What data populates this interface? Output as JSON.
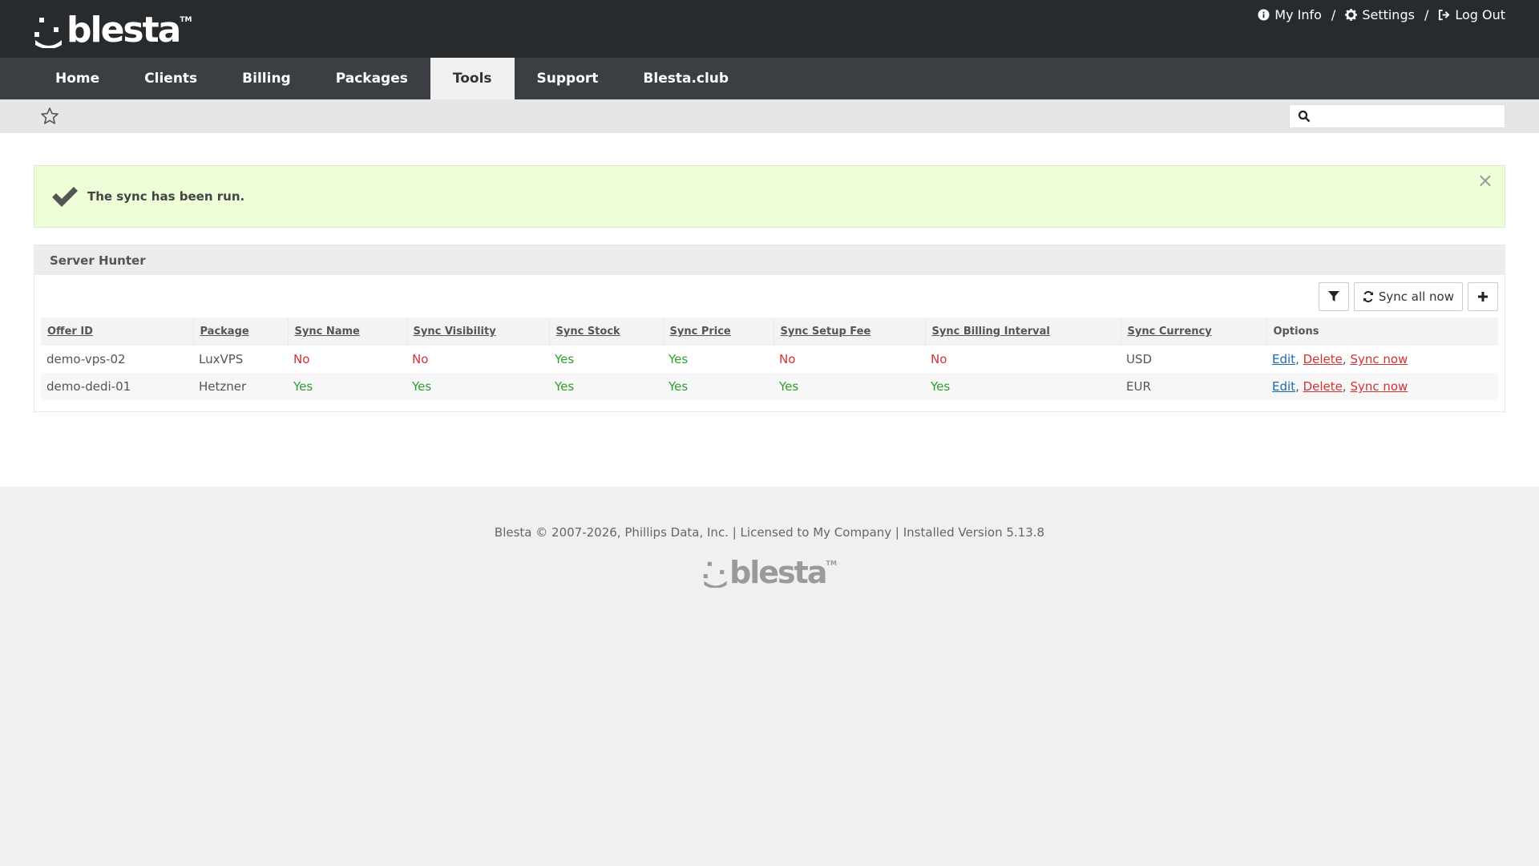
{
  "brand": {
    "name": "blesta",
    "tm": "TM"
  },
  "toplinks": {
    "my_info": "My Info",
    "settings": "Settings",
    "logout": "Log Out",
    "sep": "/"
  },
  "nav": [
    "Home",
    "Clients",
    "Billing",
    "Packages",
    "Tools",
    "Support",
    "Blesta.club"
  ],
  "nav_active": "Tools",
  "search": {
    "placeholder": ""
  },
  "alert": {
    "message": "The sync has been run.",
    "close": "×"
  },
  "panel": {
    "title": "Server Hunter",
    "sync_all_label": "Sync all now"
  },
  "table": {
    "headers": [
      "Offer ID",
      "Package",
      "Sync Name",
      "Sync Visibility",
      "Sync Stock",
      "Sync Price",
      "Sync Setup Fee",
      "Sync Billing Interval",
      "Sync Currency",
      "Options"
    ],
    "rows": [
      {
        "offer_id": "demo-vps-02",
        "package": "LuxVPS",
        "sync_name": "No",
        "sync_visibility": "No",
        "sync_stock": "Yes",
        "sync_price": "Yes",
        "sync_setup_fee": "No",
        "sync_billing_interval": "No",
        "sync_currency": "USD"
      },
      {
        "offer_id": "demo-dedi-01",
        "package": "Hetzner",
        "sync_name": "Yes",
        "sync_visibility": "Yes",
        "sync_stock": "Yes",
        "sync_price": "Yes",
        "sync_setup_fee": "Yes",
        "sync_billing_interval": "Yes",
        "sync_currency": "EUR"
      }
    ],
    "options": {
      "edit": "Edit",
      "delete": "Delete",
      "sync_now": "Sync now",
      "comma": ", "
    }
  },
  "footer": {
    "text": "Blesta © 2007-2026, Phillips Data, Inc. | Licensed to My Company | Installed Version 5.13.8"
  },
  "colors": {
    "topbar": "#282b2e",
    "nav": "#3b3f43",
    "yes": "#2ca02c",
    "no": "#d63031",
    "link": "#1a6ab0",
    "alert_bg": "#eefed8"
  }
}
